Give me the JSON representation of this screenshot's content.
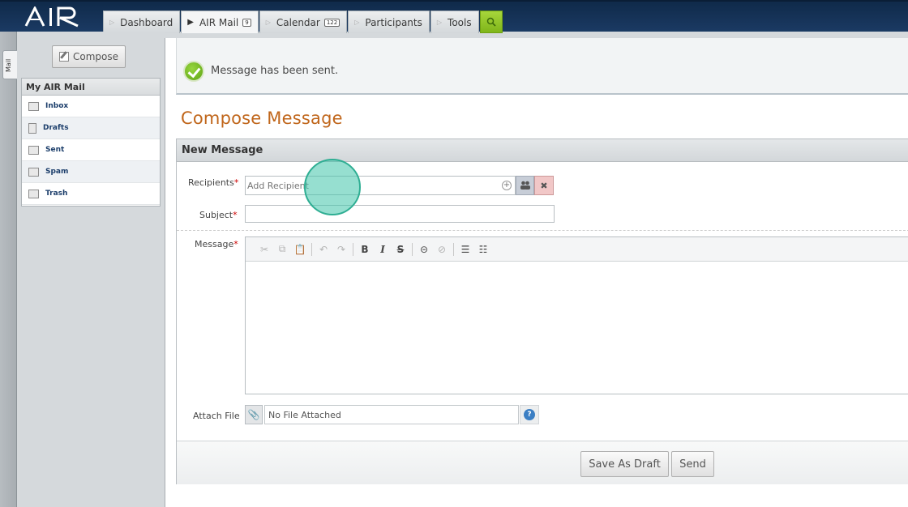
{
  "app": {
    "logo_text": "AIR"
  },
  "nav": {
    "tabs": [
      {
        "label": "Dashboard",
        "badge": ""
      },
      {
        "label": "AIR Mail",
        "badge": "9"
      },
      {
        "label": "Calendar",
        "badge": "122"
      },
      {
        "label": "Participants",
        "badge": ""
      },
      {
        "label": "Tools",
        "badge": ""
      }
    ],
    "active_tab": "AIR Mail"
  },
  "side_tab": {
    "label": "Mail"
  },
  "sidebar": {
    "compose_label": "Compose",
    "mailbox_title": "My AIR Mail",
    "items": [
      {
        "label": "Inbox",
        "icon": "envelope-icon"
      },
      {
        "label": "Drafts",
        "icon": "document-icon"
      },
      {
        "label": "Sent",
        "icon": "sent-icon"
      },
      {
        "label": "Spam",
        "icon": "spam-icon"
      },
      {
        "label": "Trash",
        "icon": "trash-icon"
      }
    ]
  },
  "notice": {
    "text": "Message has been sent."
  },
  "page": {
    "title": "Compose Message"
  },
  "form": {
    "panel_title": "New Message",
    "recipients_label": "Recipients",
    "recipients_placeholder": "Add Recipient",
    "recipients_value": "",
    "subject_label": "Subject",
    "subject_value": "",
    "message_label": "Message",
    "attach_label": "Attach File",
    "attach_value": "No File Attached",
    "required_mark": "*"
  },
  "editor_toolbar": [
    "cut",
    "copy",
    "paste",
    "undo",
    "redo",
    "bold",
    "italic",
    "strikethrough",
    "link",
    "unlink",
    "numbered-list",
    "bulleted-list"
  ],
  "actions": {
    "save_draft": "Save As Draft",
    "send": "Send"
  },
  "colors": {
    "brand_navy": "#1b3a63",
    "title_orange": "#c0661b",
    "success_green": "#6fb21e",
    "required_red": "#cc0000",
    "search_green": "#8cc21f"
  }
}
